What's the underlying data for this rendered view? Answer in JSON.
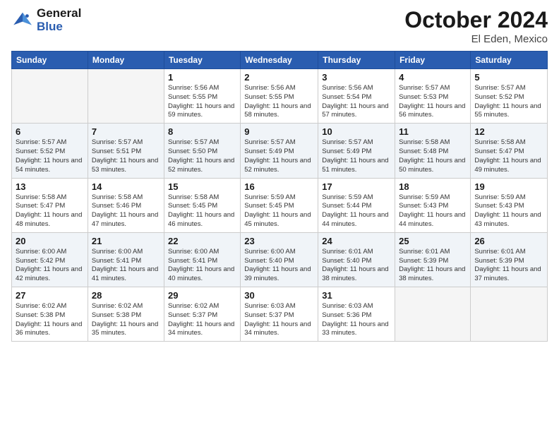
{
  "logo": {
    "line1": "General",
    "line2": "Blue"
  },
  "title": "October 2024",
  "location": "El Eden, Mexico",
  "days_header": [
    "Sunday",
    "Monday",
    "Tuesday",
    "Wednesday",
    "Thursday",
    "Friday",
    "Saturday"
  ],
  "weeks": [
    [
      {
        "day": "",
        "info": ""
      },
      {
        "day": "",
        "info": ""
      },
      {
        "day": "1",
        "info": "Sunrise: 5:56 AM\nSunset: 5:55 PM\nDaylight: 11 hours and 59 minutes."
      },
      {
        "day": "2",
        "info": "Sunrise: 5:56 AM\nSunset: 5:55 PM\nDaylight: 11 hours and 58 minutes."
      },
      {
        "day": "3",
        "info": "Sunrise: 5:56 AM\nSunset: 5:54 PM\nDaylight: 11 hours and 57 minutes."
      },
      {
        "day": "4",
        "info": "Sunrise: 5:57 AM\nSunset: 5:53 PM\nDaylight: 11 hours and 56 minutes."
      },
      {
        "day": "5",
        "info": "Sunrise: 5:57 AM\nSunset: 5:52 PM\nDaylight: 11 hours and 55 minutes."
      }
    ],
    [
      {
        "day": "6",
        "info": "Sunrise: 5:57 AM\nSunset: 5:52 PM\nDaylight: 11 hours and 54 minutes."
      },
      {
        "day": "7",
        "info": "Sunrise: 5:57 AM\nSunset: 5:51 PM\nDaylight: 11 hours and 53 minutes."
      },
      {
        "day": "8",
        "info": "Sunrise: 5:57 AM\nSunset: 5:50 PM\nDaylight: 11 hours and 52 minutes."
      },
      {
        "day": "9",
        "info": "Sunrise: 5:57 AM\nSunset: 5:49 PM\nDaylight: 11 hours and 52 minutes."
      },
      {
        "day": "10",
        "info": "Sunrise: 5:57 AM\nSunset: 5:49 PM\nDaylight: 11 hours and 51 minutes."
      },
      {
        "day": "11",
        "info": "Sunrise: 5:58 AM\nSunset: 5:48 PM\nDaylight: 11 hours and 50 minutes."
      },
      {
        "day": "12",
        "info": "Sunrise: 5:58 AM\nSunset: 5:47 PM\nDaylight: 11 hours and 49 minutes."
      }
    ],
    [
      {
        "day": "13",
        "info": "Sunrise: 5:58 AM\nSunset: 5:47 PM\nDaylight: 11 hours and 48 minutes."
      },
      {
        "day": "14",
        "info": "Sunrise: 5:58 AM\nSunset: 5:46 PM\nDaylight: 11 hours and 47 minutes."
      },
      {
        "day": "15",
        "info": "Sunrise: 5:58 AM\nSunset: 5:45 PM\nDaylight: 11 hours and 46 minutes."
      },
      {
        "day": "16",
        "info": "Sunrise: 5:59 AM\nSunset: 5:45 PM\nDaylight: 11 hours and 45 minutes."
      },
      {
        "day": "17",
        "info": "Sunrise: 5:59 AM\nSunset: 5:44 PM\nDaylight: 11 hours and 44 minutes."
      },
      {
        "day": "18",
        "info": "Sunrise: 5:59 AM\nSunset: 5:43 PM\nDaylight: 11 hours and 44 minutes."
      },
      {
        "day": "19",
        "info": "Sunrise: 5:59 AM\nSunset: 5:43 PM\nDaylight: 11 hours and 43 minutes."
      }
    ],
    [
      {
        "day": "20",
        "info": "Sunrise: 6:00 AM\nSunset: 5:42 PM\nDaylight: 11 hours and 42 minutes."
      },
      {
        "day": "21",
        "info": "Sunrise: 6:00 AM\nSunset: 5:41 PM\nDaylight: 11 hours and 41 minutes."
      },
      {
        "day": "22",
        "info": "Sunrise: 6:00 AM\nSunset: 5:41 PM\nDaylight: 11 hours and 40 minutes."
      },
      {
        "day": "23",
        "info": "Sunrise: 6:00 AM\nSunset: 5:40 PM\nDaylight: 11 hours and 39 minutes."
      },
      {
        "day": "24",
        "info": "Sunrise: 6:01 AM\nSunset: 5:40 PM\nDaylight: 11 hours and 38 minutes."
      },
      {
        "day": "25",
        "info": "Sunrise: 6:01 AM\nSunset: 5:39 PM\nDaylight: 11 hours and 38 minutes."
      },
      {
        "day": "26",
        "info": "Sunrise: 6:01 AM\nSunset: 5:39 PM\nDaylight: 11 hours and 37 minutes."
      }
    ],
    [
      {
        "day": "27",
        "info": "Sunrise: 6:02 AM\nSunset: 5:38 PM\nDaylight: 11 hours and 36 minutes."
      },
      {
        "day": "28",
        "info": "Sunrise: 6:02 AM\nSunset: 5:38 PM\nDaylight: 11 hours and 35 minutes."
      },
      {
        "day": "29",
        "info": "Sunrise: 6:02 AM\nSunset: 5:37 PM\nDaylight: 11 hours and 34 minutes."
      },
      {
        "day": "30",
        "info": "Sunrise: 6:03 AM\nSunset: 5:37 PM\nDaylight: 11 hours and 34 minutes."
      },
      {
        "day": "31",
        "info": "Sunrise: 6:03 AM\nSunset: 5:36 PM\nDaylight: 11 hours and 33 minutes."
      },
      {
        "day": "",
        "info": ""
      },
      {
        "day": "",
        "info": ""
      }
    ]
  ]
}
